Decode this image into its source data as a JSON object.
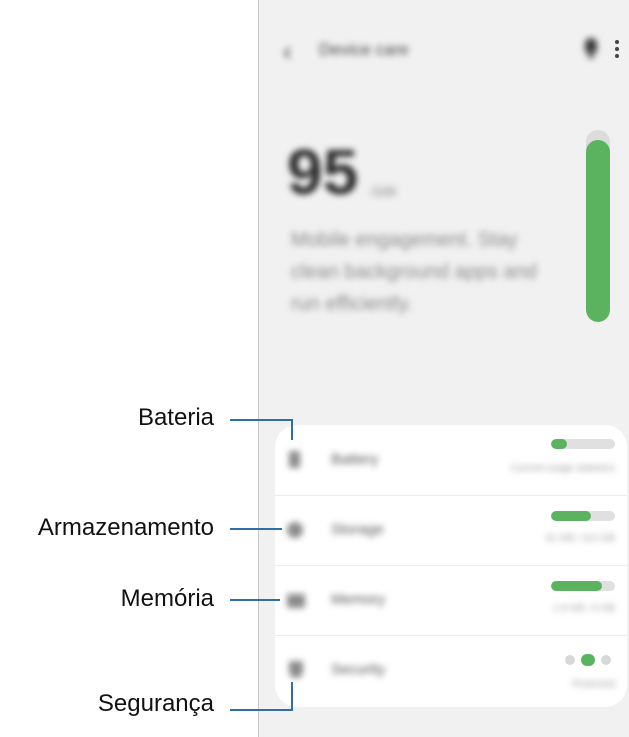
{
  "phone": {
    "appbar": {
      "back_icon": "‹",
      "title": "Device care",
      "bulb_icon": "lightbulb-icon",
      "more_icon": "more-options-icon"
    },
    "score": {
      "value": "95",
      "fraction": 0.95,
      "unit": "/100"
    },
    "summary": "Mobile engagement. Stay clean background apps and run efficiently.",
    "items": [
      {
        "id": "battery",
        "label": "Battery",
        "detail": "Current usage statistics",
        "level": 0.25,
        "icon": "battery-icon"
      },
      {
        "id": "storage",
        "label": "Storage",
        "detail": "31 GB / 112 GB",
        "level": 0.62,
        "icon": "storage-icon"
      },
      {
        "id": "memory",
        "label": "Memory",
        "detail": "1.9 GB / 4 GB",
        "level": 0.8,
        "icon": "memory-icon"
      },
      {
        "id": "security",
        "label": "Security",
        "detail": "Protected",
        "icon": "shield-icon"
      }
    ]
  },
  "callouts": {
    "battery": "Bateria",
    "storage": "Armazenamento",
    "memory": "Memória",
    "security": "Segurança"
  },
  "colors": {
    "accent": "#5cb35f",
    "callout_line": "#2f6fa8"
  }
}
